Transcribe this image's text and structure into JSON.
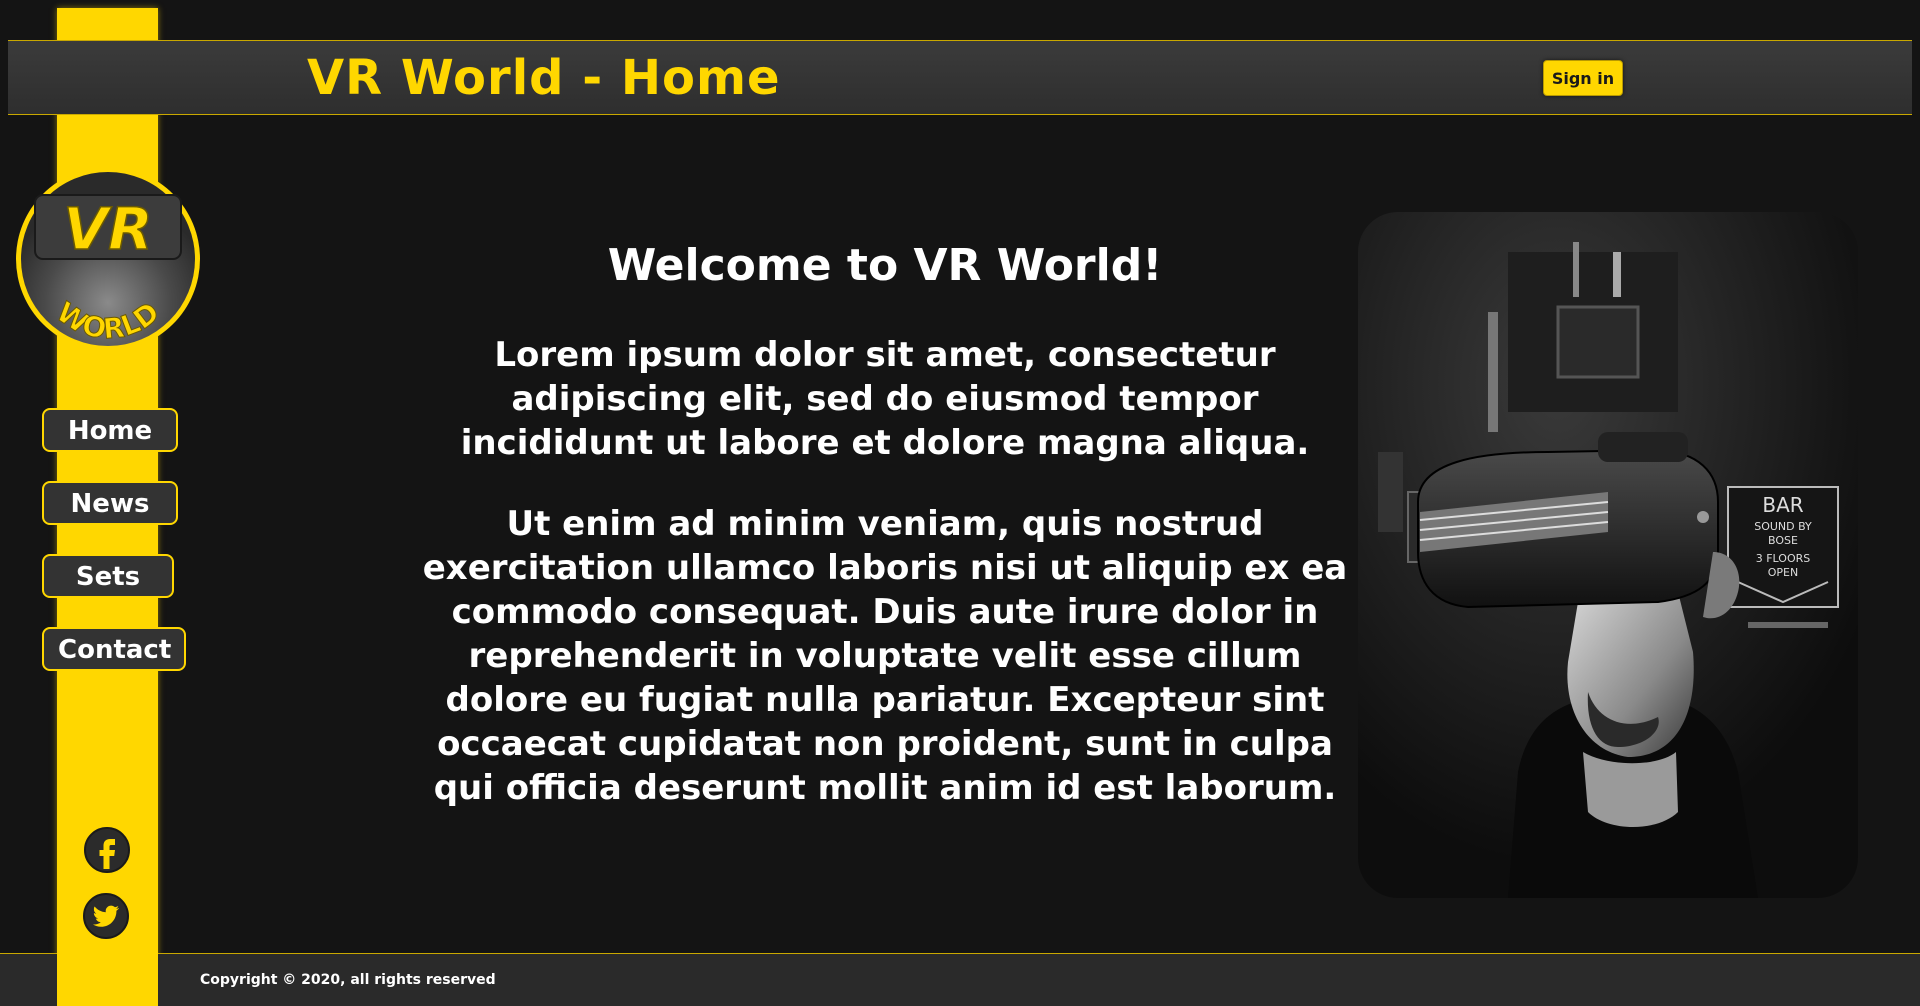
{
  "header": {
    "title": "VR World - Home",
    "signin_label": "Sign in"
  },
  "logo": {
    "text_top": "VR",
    "text_bottom": "WORLD"
  },
  "nav": {
    "items": [
      {
        "label": "Home"
      },
      {
        "label": "News"
      },
      {
        "label": "Sets"
      },
      {
        "label": "Contact"
      }
    ]
  },
  "social": {
    "icons": [
      "facebook-icon",
      "twitter-icon"
    ]
  },
  "main": {
    "heading": "Welcome to VR World!",
    "paragraph_1": "Lorem ipsum dolor sit amet, consectetur adipiscing elit, sed do eiusmod tempor incididunt ut labore et dolore magna aliqua.",
    "paragraph_2": "Ut enim ad minim veniam, quis nostrud exercitation ullamco laboris nisi ut aliquip ex ea commodo consequat. Duis aute irure dolor in reprehenderit in voluptate velit esse cillum dolore eu fugiat nulla pariatur. Excepteur sint occaecat cupidatat non proident, sunt in culpa qui officia deserunt mollit anim id est laborum."
  },
  "hero": {
    "sign_text_1": "BAR",
    "sign_text_2": "SOUND BY",
    "sign_text_3": "BOSE",
    "sign_text_4": "3 FLOORS",
    "sign_text_5": "OPEN"
  },
  "footer": {
    "copyright": "Copyright © 2020, all rights reserved"
  },
  "colors": {
    "accent": "#ffd700",
    "background": "#141414",
    "header_bg": "#333333"
  }
}
